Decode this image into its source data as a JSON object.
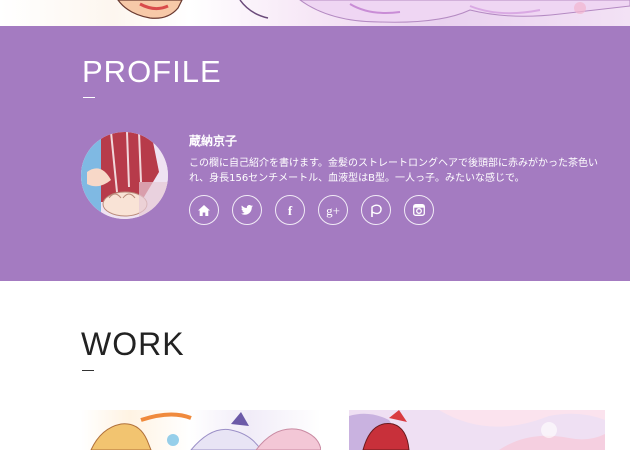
{
  "profile": {
    "title": "PROFILE",
    "name": "蔵納京子",
    "bio_line1": "この欄に自己紹介を書けます。金髪のストレートロングヘアで後頭部に赤みがかった茶色い",
    "bio_line2": "れ、身長156センチメートル、血液型はB型。一人っ子。みたいな感じで。",
    "social": [
      {
        "icon": "home-icon"
      },
      {
        "icon": "twitter-icon"
      },
      {
        "icon": "facebook-icon",
        "glyph": "f"
      },
      {
        "icon": "google-plus-icon",
        "glyph": "g+"
      },
      {
        "icon": "pixiv-icon"
      },
      {
        "icon": "instagram-icon"
      }
    ]
  },
  "work": {
    "title": "WORK"
  },
  "colors": {
    "profile_bg": "#a47bc1",
    "text_light": "#ffffff",
    "text_dark": "#222222"
  }
}
